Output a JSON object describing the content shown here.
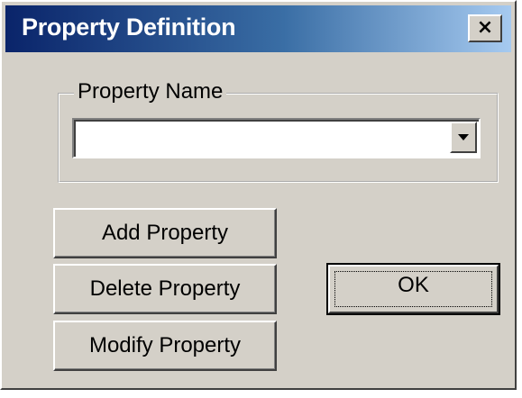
{
  "window": {
    "title": "Property Definition",
    "close_label": "×"
  },
  "property_name": {
    "group_label": "Property Name",
    "value": ""
  },
  "buttons": {
    "add": "Add Property",
    "delete": "Delete Property",
    "modify": "Modify Property",
    "ok": "OK"
  },
  "colors": {
    "title_gradient_start": "#0a246a",
    "title_gradient_end": "#a6caf0",
    "face": "#d4d0c8"
  },
  "icons": {
    "close": "close-icon",
    "dropdown": "chevron-down-icon"
  }
}
